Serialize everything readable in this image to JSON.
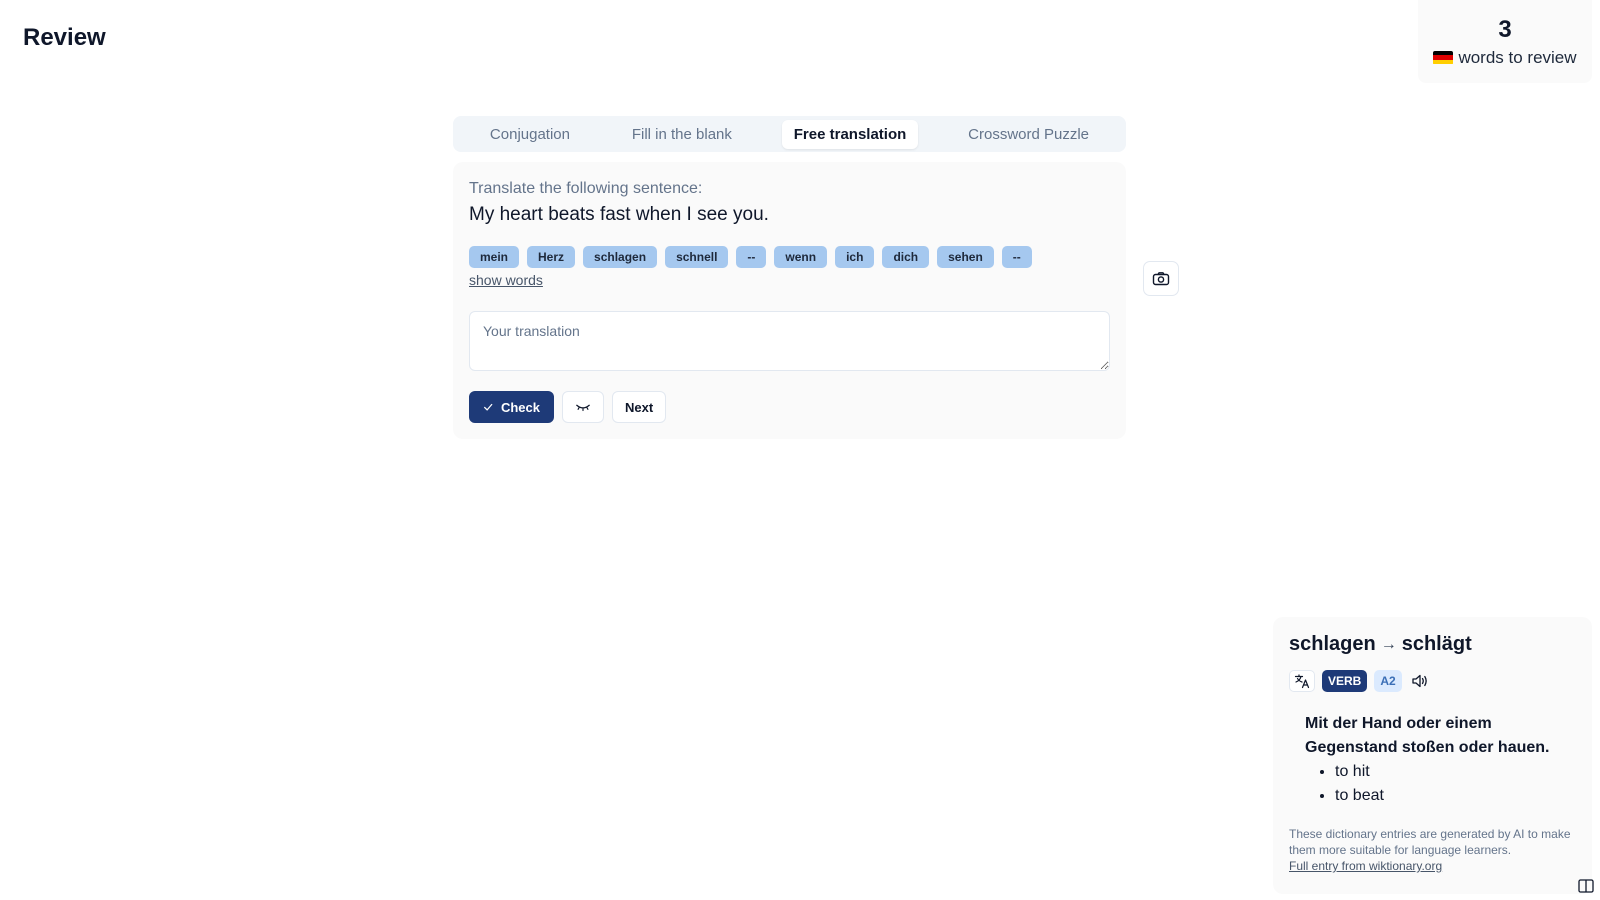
{
  "page": {
    "title": "Review"
  },
  "review_counter": {
    "count": "3",
    "label": "words to review",
    "flag_colors": [
      "#000000",
      "#dd0000",
      "#ffce00"
    ]
  },
  "tabs": [
    {
      "label": "Conjugation",
      "active": false
    },
    {
      "label": "Fill in the blank",
      "active": false
    },
    {
      "label": "Free translation",
      "active": true
    },
    {
      "label": "Crossword Puzzle",
      "active": false
    }
  ],
  "exercise": {
    "prompt": "Translate the following sentence:",
    "sentence": "My heart beats fast when I see you.",
    "word_chips": [
      "mein",
      "Herz",
      "schlagen",
      "schnell",
      "--",
      "wenn",
      "ich",
      "dich",
      "sehen",
      "--"
    ],
    "show_words_label": "show words",
    "input_placeholder": "Your translation",
    "input_value": "",
    "check_label": "Check",
    "next_label": "Next"
  },
  "icons": {
    "camera": "camera-icon",
    "check": "check-icon",
    "eye_closed": "eye-closed-icon",
    "translate": "translate-icon",
    "audio": "speaker-icon",
    "sidebar": "sidebar-icon"
  },
  "dictionary": {
    "lemma": "schlagen",
    "arrow": "→",
    "form": "schlägt",
    "pos": "VERB",
    "level": "A2",
    "definition": "Mit der Hand oder einem Gegenstand stoßen oder hauen.",
    "senses": [
      "to hit",
      "to beat"
    ],
    "disclaimer": "These dictionary entries are generated by AI to make them more suitable for language learners.",
    "link_label": "Full entry from wiktionary.org"
  },
  "colors": {
    "primary": "#1e3a78",
    "chip": "#a5c8ef",
    "level_tag_bg": "#dbeafe"
  }
}
